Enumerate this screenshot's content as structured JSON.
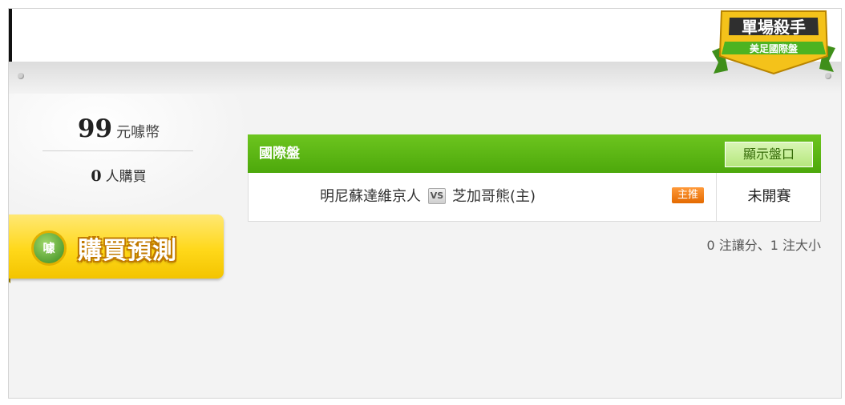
{
  "price": {
    "amount": "99",
    "unit": "元噱幣"
  },
  "buyers": {
    "count": "0",
    "unit": "人購買"
  },
  "buy_button": {
    "label": "購買預測",
    "badge_text": "噱"
  },
  "badge": {
    "title": "單場殺手",
    "subtitle": "美足國際盤"
  },
  "panel": {
    "title": "國際盤",
    "show_odds_label": "顯示盤口",
    "match": {
      "home_team": "明尼蘇達維京人",
      "vs_label": "VS",
      "away_team": "芝加哥熊(主)",
      "pick_badge": "主推",
      "status": "未開賽"
    },
    "summary": "0 注讓分、1 注大小"
  },
  "colors": {
    "green_header": "#4da80b",
    "gold_button": "#ffd81a",
    "orange_badge": "#e46a00"
  }
}
